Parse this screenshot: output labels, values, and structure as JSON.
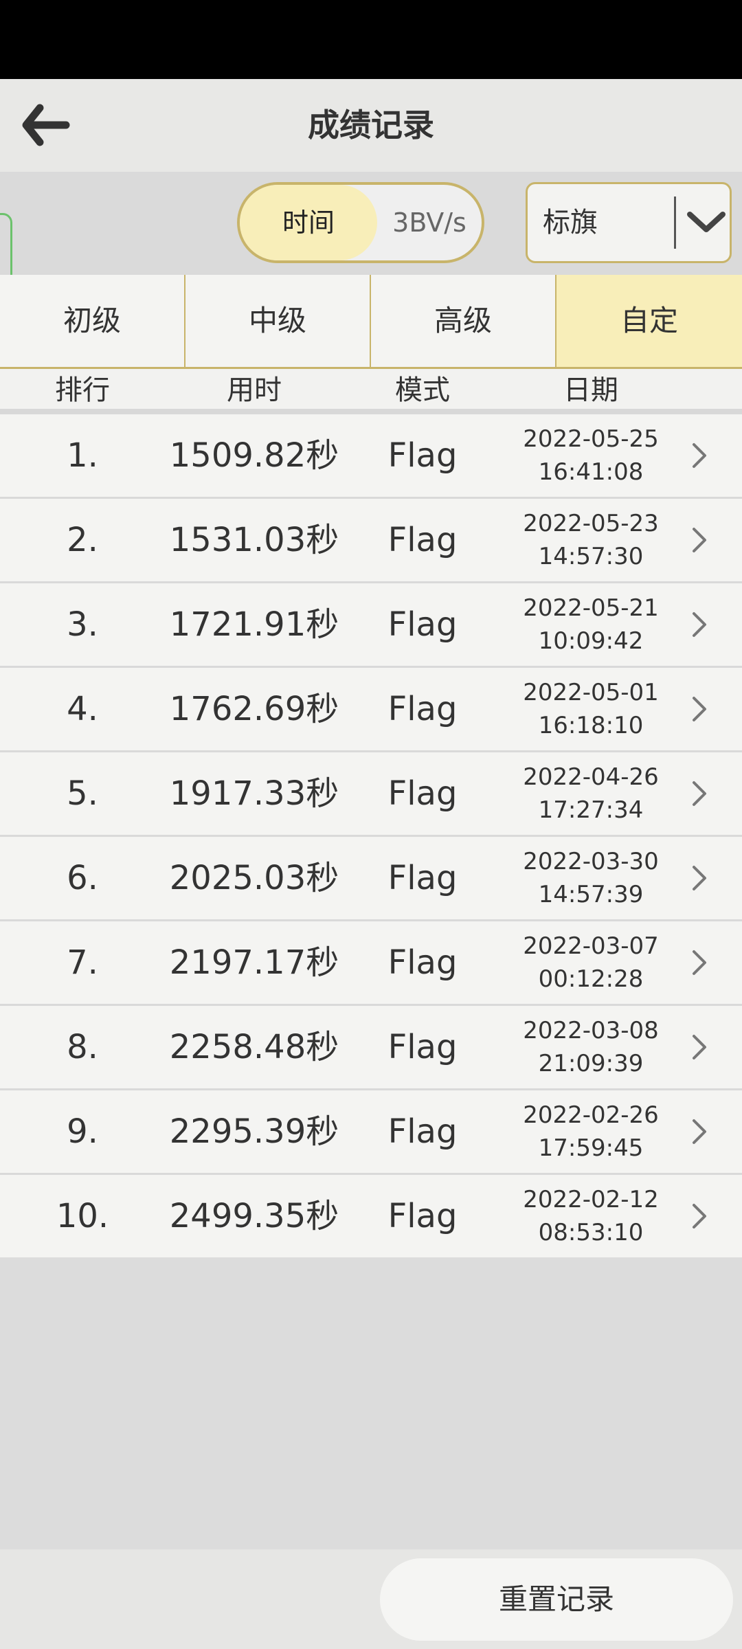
{
  "header": {
    "title": "成绩记录"
  },
  "filters": {
    "sort_options": [
      {
        "label": "时间",
        "selected": true
      },
      {
        "label": "3BV/s",
        "selected": false
      }
    ],
    "mode_dropdown": {
      "value": "标旗"
    }
  },
  "tabs": [
    {
      "label": "初级",
      "active": false
    },
    {
      "label": "中级",
      "active": false
    },
    {
      "label": "高级",
      "active": false
    },
    {
      "label": "自定",
      "active": true
    }
  ],
  "columns": {
    "rank": "排行",
    "time": "用时",
    "mode": "模式",
    "date": "日期"
  },
  "records": [
    {
      "rank": "1.",
      "time": "1509.82秒",
      "mode": "Flag",
      "date": "2022-05-25",
      "clock": "16:41:08"
    },
    {
      "rank": "2.",
      "time": "1531.03秒",
      "mode": "Flag",
      "date": "2022-05-23",
      "clock": "14:57:30"
    },
    {
      "rank": "3.",
      "time": "1721.91秒",
      "mode": "Flag",
      "date": "2022-05-21",
      "clock": "10:09:42"
    },
    {
      "rank": "4.",
      "time": "1762.69秒",
      "mode": "Flag",
      "date": "2022-05-01",
      "clock": "16:18:10"
    },
    {
      "rank": "5.",
      "time": "1917.33秒",
      "mode": "Flag",
      "date": "2022-04-26",
      "clock": "17:27:34"
    },
    {
      "rank": "6.",
      "time": "2025.03秒",
      "mode": "Flag",
      "date": "2022-03-30",
      "clock": "14:57:39"
    },
    {
      "rank": "7.",
      "time": "2197.17秒",
      "mode": "Flag",
      "date": "2022-03-07",
      "clock": "00:12:28"
    },
    {
      "rank": "8.",
      "time": "2258.48秒",
      "mode": "Flag",
      "date": "2022-03-08",
      "clock": "21:09:39"
    },
    {
      "rank": "9.",
      "time": "2295.39秒",
      "mode": "Flag",
      "date": "2022-02-26",
      "clock": "17:59:45"
    },
    {
      "rank": "10.",
      "time": "2499.35秒",
      "mode": "Flag",
      "date": "2022-02-12",
      "clock": "08:53:10"
    }
  ],
  "footer": {
    "reset_label": "重置记录"
  },
  "colors": {
    "accent_border": "#c8b46a",
    "active_fill": "#f8eeb9",
    "side_tab_border": "#6cc26c"
  },
  "icons": {
    "back": "arrow-left-icon",
    "dropdown": "chevron-down-icon",
    "row": "chevron-right-icon"
  }
}
